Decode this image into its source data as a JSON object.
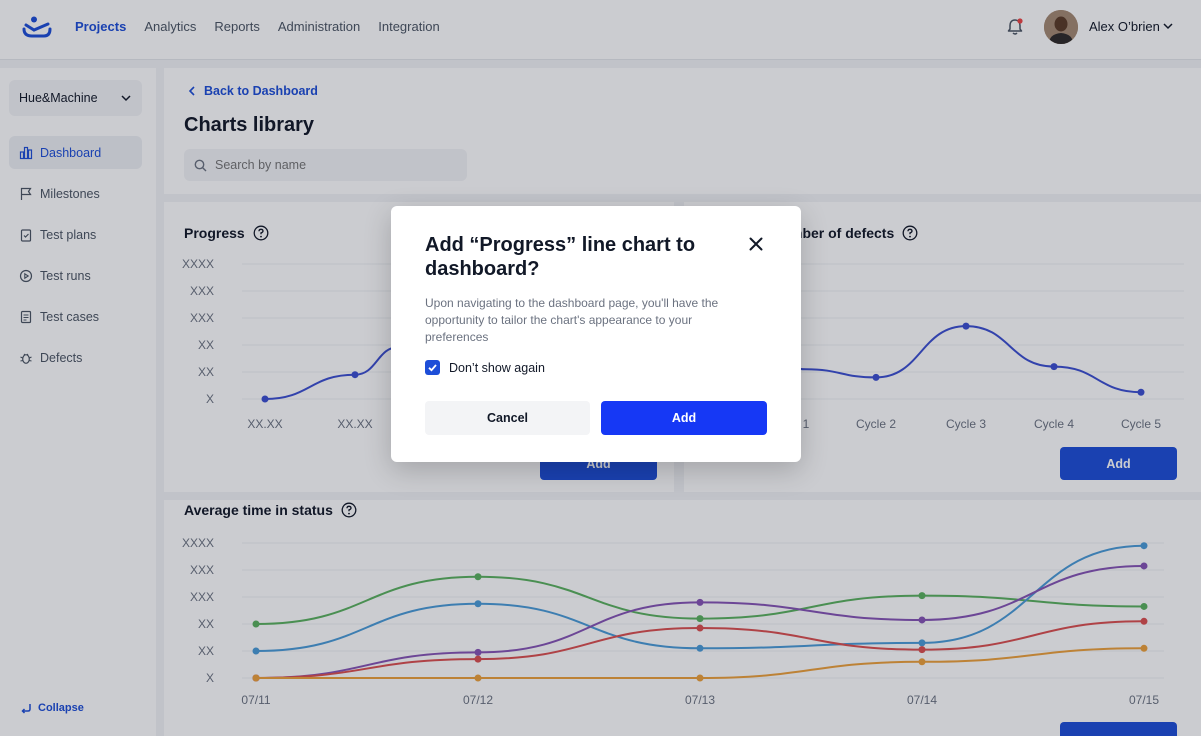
{
  "topbar": {
    "nav": [
      "Projects",
      "Analytics",
      "Reports",
      "Administration",
      "Integration"
    ],
    "active_nav": "Projects",
    "user_name": "Alex O’brien"
  },
  "sidebar": {
    "workspace": "Hue&Machine",
    "items": [
      "Dashboard",
      "Milestones",
      "Test plans",
      "Test runs",
      "Test cases",
      "Defects"
    ],
    "active_item": "Dashboard",
    "collapse_label": "Collapse"
  },
  "header": {
    "back_label": "Back to Dashboard",
    "title": "Charts library",
    "search_placeholder": "Search by name"
  },
  "cards": {
    "progress_title": "Progress",
    "defects_title": "mber of defects",
    "avg_title": "Average time in status",
    "add_label": "Add"
  },
  "modal": {
    "title": "Add “Progress” line chart to dashboard?",
    "description": "Upon navigating to the dashboard page, you'll have the opportunity to tailor the chart's appearance to your preferences",
    "checkbox_label": "Don’t show again",
    "checkbox_checked": true,
    "cancel_label": "Cancel",
    "add_label": "Add"
  },
  "colors": {
    "accent": "#1d4ed8",
    "modal_add": "#1638f5",
    "line_blue": "#3b4fd1"
  },
  "chart_data": [
    {
      "type": "line",
      "title": "Progress",
      "y_ticks": [
        "XXXX",
        "XXX",
        "XXX",
        "XX",
        "XX",
        "X"
      ],
      "categories": [
        "XX.XX",
        "XX.XX"
      ],
      "series": [
        {
          "values": [
            0,
            0.9
          ]
        }
      ]
    },
    {
      "type": "line",
      "title": "mber of defects",
      "categories": [
        "1",
        "Cycle 2",
        "Cycle 3",
        "Cycle 4",
        "Cycle 5"
      ],
      "series": [
        {
          "values": [
            1.1,
            0.8,
            2.7,
            1.2,
            0.25
          ]
        }
      ]
    },
    {
      "type": "line",
      "title": "Average time in status",
      "y_ticks": [
        "XXXX",
        "XXX",
        "XXX",
        "XX",
        "XX",
        "X"
      ],
      "categories": [
        "07/11",
        "07/12",
        "07/13",
        "07/14",
        "07/15"
      ],
      "ylim": [
        0,
        5
      ],
      "series": [
        {
          "color": "#5ab15e",
          "values": [
            2.0,
            3.75,
            2.2,
            3.05,
            2.65
          ]
        },
        {
          "color": "#4a9bd8",
          "values": [
            1.0,
            2.75,
            1.1,
            1.3,
            4.9
          ]
        },
        {
          "color": "#8654b5",
          "values": [
            0,
            0.95,
            2.8,
            2.15,
            4.15
          ]
        },
        {
          "color": "#db4f4f",
          "values": [
            0,
            0.7,
            1.85,
            1.05,
            2.1
          ]
        },
        {
          "color": "#eda13a",
          "values": [
            0,
            0,
            0,
            0.6,
            1.1
          ]
        }
      ]
    }
  ]
}
